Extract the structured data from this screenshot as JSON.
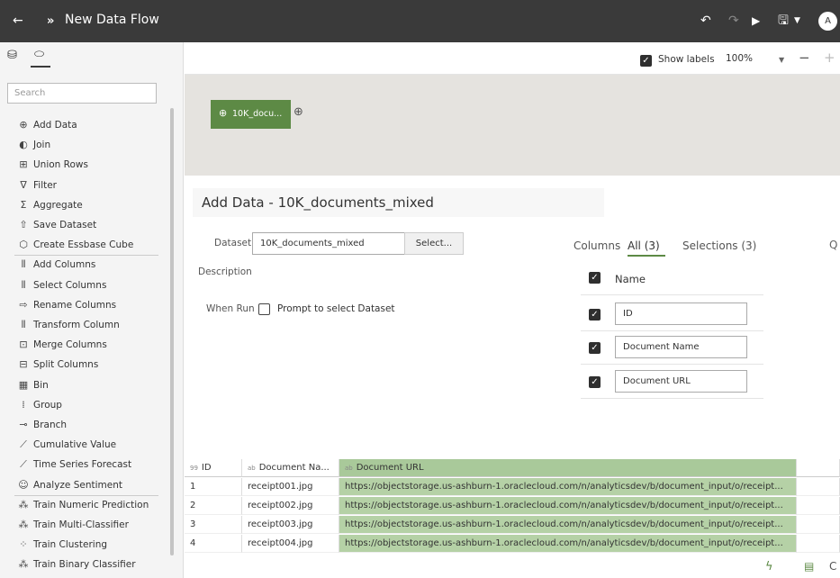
{
  "header": {
    "back_icon": "back-arrow-icon",
    "flow_icon": "data-flow-icon",
    "title": "New Data Flow",
    "avatar_letter": "A"
  },
  "sidebar": {
    "search_placeholder": "Search",
    "steps": [
      {
        "label": "Add Data",
        "icon": "add-data-icon",
        "glyph": "⊕"
      },
      {
        "label": "Join",
        "icon": "join-icon",
        "glyph": "◐"
      },
      {
        "label": "Union Rows",
        "icon": "union-rows-icon",
        "glyph": "⊞"
      },
      {
        "label": "Filter",
        "icon": "filter-icon",
        "glyph": "∇"
      },
      {
        "label": "Aggregate",
        "icon": "aggregate-icon",
        "glyph": "Σ"
      },
      {
        "label": "Save Dataset",
        "icon": "save-dataset-icon",
        "glyph": "⇧"
      },
      {
        "label": "Create Essbase Cube",
        "icon": "essbase-cube-icon",
        "glyph": "⬡"
      },
      {
        "label": "Add Columns",
        "icon": "add-columns-icon",
        "glyph": "⫴"
      },
      {
        "label": "Select Columns",
        "icon": "select-columns-icon",
        "glyph": "⫴"
      },
      {
        "label": "Rename Columns",
        "icon": "rename-columns-icon",
        "glyph": "⇨"
      },
      {
        "label": "Transform Column",
        "icon": "transform-column-icon",
        "glyph": "⫴"
      },
      {
        "label": "Merge Columns",
        "icon": "merge-columns-icon",
        "glyph": "⊡"
      },
      {
        "label": "Split Columns",
        "icon": "split-columns-icon",
        "glyph": "⊟"
      },
      {
        "label": "Bin",
        "icon": "bin-icon",
        "glyph": "▦"
      },
      {
        "label": "Group",
        "icon": "group-icon",
        "glyph": "⁞"
      },
      {
        "label": "Branch",
        "icon": "branch-icon",
        "glyph": "⊸"
      },
      {
        "label": "Cumulative Value",
        "icon": "cumulative-value-icon",
        "glyph": "⟋"
      },
      {
        "label": "Time Series Forecast",
        "icon": "forecast-icon",
        "glyph": "⟋"
      },
      {
        "label": "Analyze Sentiment",
        "icon": "sentiment-icon",
        "glyph": "☺"
      },
      {
        "label": "Train Numeric Prediction",
        "icon": "numeric-prediction-icon",
        "glyph": "⁂"
      },
      {
        "label": "Train Multi-Classifier",
        "icon": "multi-classifier-icon",
        "glyph": "⁂"
      },
      {
        "label": "Train Clustering",
        "icon": "clustering-icon",
        "glyph": "⁘"
      },
      {
        "label": "Train Binary Classifier",
        "icon": "binary-classifier-icon",
        "glyph": "⁂"
      }
    ]
  },
  "toolbar": {
    "show_labels": "Show labels",
    "show_labels_checked": true,
    "zoom": "100%"
  },
  "canvas": {
    "node_label": "10K_docu..."
  },
  "panel": {
    "title": "Add Data - 10K_documents_mixed",
    "dataset_label": "Dataset",
    "dataset_value": "10K_documents_mixed",
    "select_button": "Select...",
    "description_label": "Description",
    "when_run_label": "When Run",
    "prompt_label": "Prompt to select Dataset",
    "columns_label": "Columns",
    "tab_all": "All (3)",
    "tab_selections": "Selections (3)",
    "name_header": "Name",
    "columns": [
      "ID",
      "Document Name",
      "Document URL"
    ]
  },
  "table": {
    "headers": [
      {
        "type": "99",
        "label": "ID"
      },
      {
        "type": "ab",
        "label": "Document Na..."
      },
      {
        "type": "ab",
        "label": "Document URL"
      }
    ],
    "rows": [
      [
        "1",
        "receipt001.jpg",
        "https://objectstorage.us-ashburn-1.oraclecloud.com/n/analyticsdev/b/document_input/o/receipt..."
      ],
      [
        "2",
        "receipt002.jpg",
        "https://objectstorage.us-ashburn-1.oraclecloud.com/n/analyticsdev/b/document_input/o/receipt..."
      ],
      [
        "3",
        "receipt003.jpg",
        "https://objectstorage.us-ashburn-1.oraclecloud.com/n/analyticsdev/b/document_input/o/receipt..."
      ],
      [
        "4",
        "receipt004.jpg",
        "https://objectstorage.us-ashburn-1.oraclecloud.com/n/analyticsdev/b/document_input/o/receipt..."
      ]
    ]
  },
  "colors": {
    "header_bg": "#3a3a3a",
    "node_green": "#5d8a45",
    "url_highlight": "#b5d1a6"
  }
}
